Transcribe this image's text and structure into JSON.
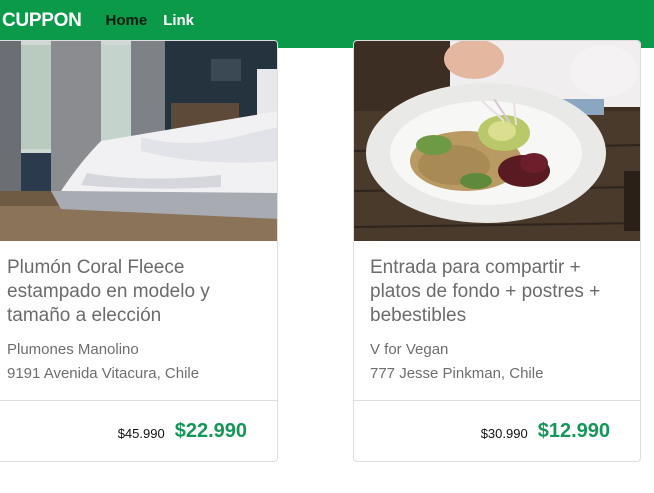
{
  "navbar": {
    "brand": "CUPPON",
    "links": [
      "Home",
      "Link"
    ]
  },
  "cards": [
    {
      "title": "Plumón Coral Fleece estampado en modelo y tamaño a elección",
      "merchant": "Plumones Manolino",
      "address": "9191 Avenida Vitacura, Chile",
      "price_old": "$45.990",
      "price_new": "$22.990",
      "image": "bedroom-bed-photo"
    },
    {
      "title": "Entrada para compartir + platos de fondo + postres + bebestibles",
      "merchant": "V for Vegan",
      "address": "777 Jesse Pinkman, Chile",
      "price_old": "$30.990",
      "price_new": "$12.990",
      "image": "vegan-salad-plate-photo"
    }
  ],
  "colors": {
    "navbar": "#0a9a4a",
    "price_new": "#15975a"
  }
}
